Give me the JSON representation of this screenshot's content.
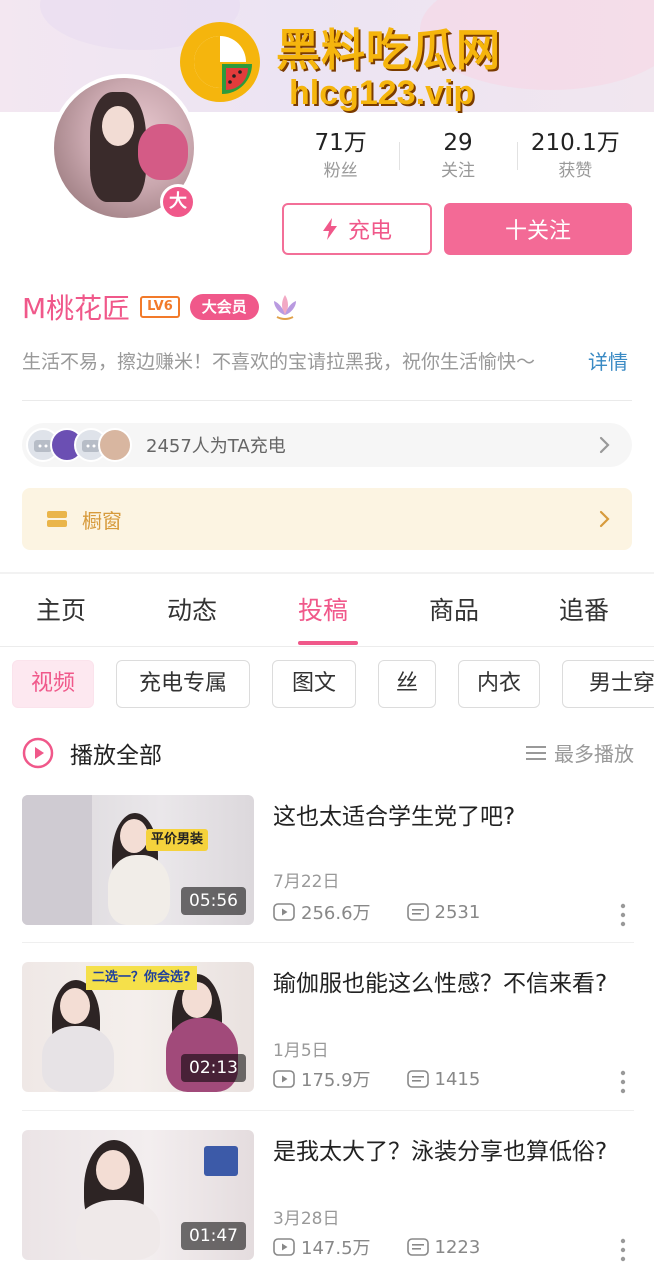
{
  "watermark": {
    "title": "黑料吃瓜网",
    "subtitle": "hlcg123.vip"
  },
  "profile": {
    "avatar_badge": "大",
    "name": "M桃花匠",
    "level": "LV6",
    "vip_label": "大会员",
    "bio": "生活不易，擦边赚米！不喜欢的宝请拉黑我，祝你生活愉快～",
    "bio_more": "详情"
  },
  "stats": [
    {
      "value": "71万",
      "label": "粉丝"
    },
    {
      "value": "29",
      "label": "关注"
    },
    {
      "value": "210.1万",
      "label": "获赞"
    }
  ],
  "buttons": {
    "charge": "充电",
    "follow": "十关注"
  },
  "charge_row": {
    "text": "2457人为TA充电"
  },
  "window_row": {
    "text": "橱窗"
  },
  "tabs": [
    {
      "label": "主页",
      "active": false
    },
    {
      "label": "动态",
      "active": false
    },
    {
      "label": "投稿",
      "active": true
    },
    {
      "label": "商品",
      "active": false
    },
    {
      "label": "追番",
      "active": false
    }
  ],
  "chips": [
    {
      "label": "视频",
      "active": true
    },
    {
      "label": "充电专属",
      "active": false
    },
    {
      "label": "图文",
      "active": false
    },
    {
      "label": "丝",
      "active": false
    },
    {
      "label": "内衣",
      "active": false
    },
    {
      "label": "男士穿",
      "active": false
    }
  ],
  "list_header": {
    "play_all": "播放全部",
    "sort": "最多播放"
  },
  "videos": [
    {
      "title": "这也太适合学生党了吧?",
      "date": "7月22日",
      "views": "256.6万",
      "danmaku": "2531",
      "duration": "05:56",
      "thumb_caption": "平价男装"
    },
    {
      "title": "瑜伽服也能这么性感？不信来看?",
      "date": "1月5日",
      "views": "175.9万",
      "danmaku": "1415",
      "duration": "02:13",
      "thumb_caption": "二选一？你会选?"
    },
    {
      "title": "是我太大了？泳装分享也算低俗?",
      "date": "3月28日",
      "views": "147.5万",
      "danmaku": "1223",
      "duration": "01:47"
    }
  ],
  "colors": {
    "accent": "#f0588a",
    "link": "#3a8ac4",
    "window_text": "#d79b3d",
    "watermark": "#f5b50d"
  },
  "icons": [
    "bolt-icon",
    "chevron-right-icon",
    "window-icon",
    "play-circle-icon",
    "sort-icon",
    "views-icon",
    "danmaku-icon",
    "more-vertical-icon",
    "lotus-icon"
  ]
}
